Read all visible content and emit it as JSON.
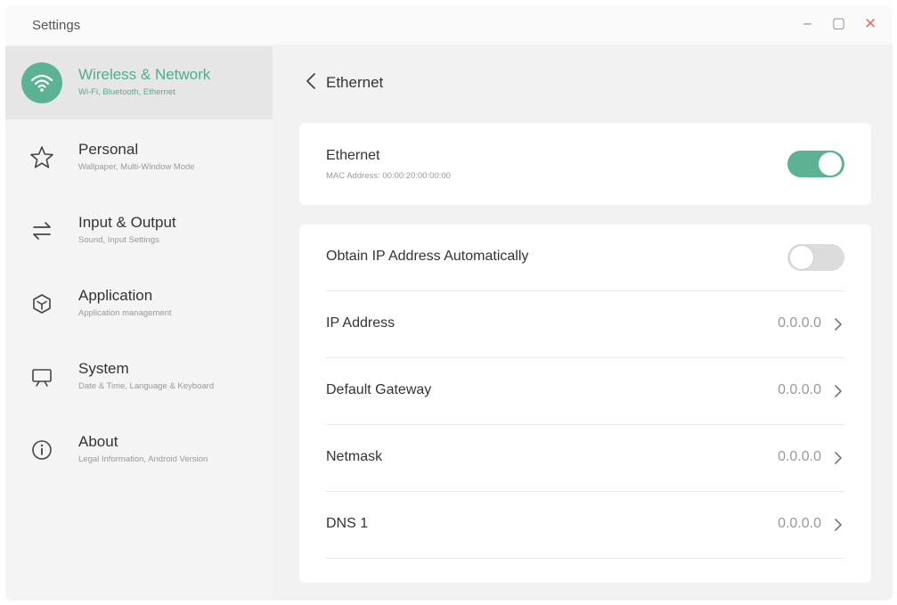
{
  "window": {
    "title": "Settings",
    "minimize": "–",
    "maximize": "▢",
    "close": "✕"
  },
  "sidebar": {
    "items": [
      {
        "title": "Wireless & Network",
        "subtitle": "Wi-Fi, Bluetooth, Ethernet",
        "icon": "wifi-icon",
        "active": true
      },
      {
        "title": "Personal",
        "subtitle": "Wallpaper, Multi-Window Mode",
        "icon": "star-icon",
        "active": false
      },
      {
        "title": "Input & Output",
        "subtitle": "Sound, Input Settings",
        "icon": "swap-arrows-icon",
        "active": false
      },
      {
        "title": "Application",
        "subtitle": "Application management",
        "icon": "box-icon",
        "active": false
      },
      {
        "title": "System",
        "subtitle": "Date & Time, Language & Keyboard",
        "icon": "monitor-icon",
        "active": false
      },
      {
        "title": "About",
        "subtitle": "Legal Information, Android Version",
        "icon": "info-icon",
        "active": false
      }
    ]
  },
  "main": {
    "back_title": "Ethernet",
    "ethernet_card": {
      "title": "Ethernet",
      "mac": "MAC Address: 00:00:20:00:00:00",
      "enabled": true
    },
    "ip_card": {
      "auto_label": "Obtain IP Address Automatically",
      "auto_enabled": false,
      "rows": [
        {
          "label": "IP Address",
          "value": "0.0.0.0"
        },
        {
          "label": "Default Gateway",
          "value": "0.0.0.0"
        },
        {
          "label": "Netmask",
          "value": "0.0.0.0"
        },
        {
          "label": "DNS 1",
          "value": "0.0.0.0"
        }
      ]
    }
  },
  "colors": {
    "accent": "#5bb394",
    "close": "#e37373",
    "toggle_off": "#dcdcdc"
  }
}
